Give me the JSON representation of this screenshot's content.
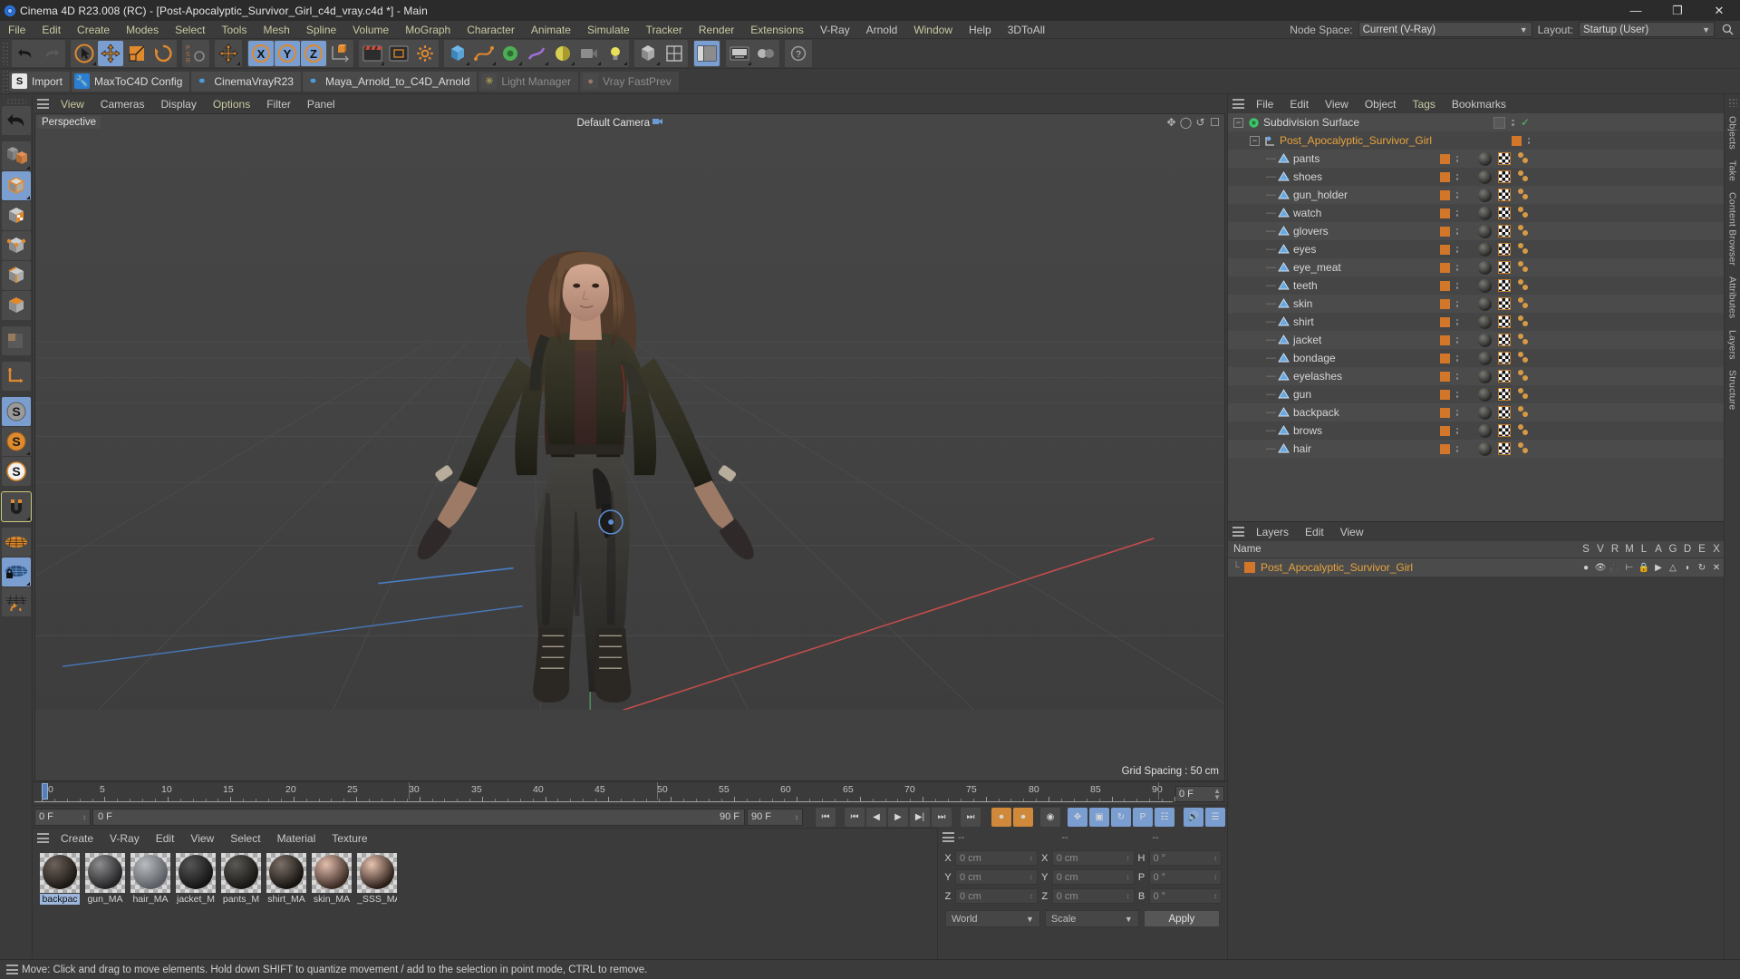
{
  "titlebar": {
    "app_name": "Cinema 4D R23.008 (RC)",
    "title": "Cinema 4D R23.008 (RC) - [Post-Apocalyptic_Survivor_Girl_c4d_vray.c4d *] - Main",
    "minimize": "—",
    "maximize": "❐",
    "close": "✕"
  },
  "menubar": {
    "items": [
      "File",
      "Edit",
      "Create",
      "Modes",
      "Select",
      "Tools",
      "Mesh",
      "Spline",
      "Volume",
      "MoGraph",
      "Character",
      "Animate",
      "Simulate",
      "Tracker",
      "Render",
      "Extensions",
      "V-Ray",
      "Arnold",
      "Window",
      "Help",
      "3DToAll"
    ],
    "node_space_label": "Node Space:",
    "node_space_value": "Current (V-Ray)",
    "layout_label": "Layout:",
    "layout_value": "Startup (User)",
    "search_icon": "search-icon"
  },
  "plugin_bar": {
    "items": [
      {
        "label": "Import",
        "icon": "import-icon",
        "dim": false
      },
      {
        "label": "MaxToC4D Config",
        "icon": "wrench-icon",
        "dim": false
      },
      {
        "label": "CinemaVrayR23",
        "icon": "python-icon",
        "dim": false
      },
      {
        "label": "Maya_Arnold_to_C4D_Arnold",
        "icon": "python-icon",
        "dim": false
      },
      {
        "label": "Light Manager",
        "icon": "light-icon",
        "dim": true
      },
      {
        "label": "Vray FastPrev",
        "icon": "vray-icon",
        "dim": true
      }
    ]
  },
  "viewport": {
    "menu": [
      "View",
      "Cameras",
      "Display",
      "Options",
      "Filter",
      "Panel"
    ],
    "label": "Perspective",
    "camera": "Default Camera",
    "grid_spacing": "Grid Spacing : 50 cm"
  },
  "timeline": {
    "ticks": [
      "0",
      "5",
      "10",
      "15",
      "20",
      "25",
      "30",
      "35",
      "40",
      "45",
      "50",
      "55",
      "60",
      "65",
      "70",
      "75",
      "80",
      "85",
      "90"
    ],
    "current_frame": "0 F",
    "start_frame": "0 F",
    "end_frame": "90 F",
    "preview_start": "0 F",
    "preview_end": "90 F",
    "max_frame": "90 F"
  },
  "material_manager": {
    "menu": [
      "Create",
      "V-Ray",
      "Edit",
      "View",
      "Select",
      "Material",
      "Texture"
    ],
    "materials": [
      {
        "name": "backpack_MAT",
        "short": "backpac",
        "selected": true,
        "c1": "#6e625c",
        "c2": "#1c1713"
      },
      {
        "name": "gun_MAT",
        "short": "gun_MA",
        "selected": false,
        "c1": "#8d8d8f",
        "c2": "#232325"
      },
      {
        "name": "hair_MAT",
        "short": "hair_MA",
        "selected": false,
        "c1": "#b9bcc0",
        "c2": "#5a5d63"
      },
      {
        "name": "jacket_MAT",
        "short": "jacket_M",
        "selected": false,
        "c1": "#565656",
        "c2": "#141414"
      },
      {
        "name": "pants_MAT",
        "short": "pants_M",
        "selected": false,
        "c1": "#5b5954",
        "c2": "#171614"
      },
      {
        "name": "shirt_MAT",
        "short": "shirt_MA",
        "selected": false,
        "c1": "#7c7068",
        "c2": "#15120f"
      },
      {
        "name": "skin_MAT",
        "short": "skin_MA",
        "selected": false,
        "c1": "#e4bfae",
        "c2": "#3a2a24"
      },
      {
        "name": "_SSS_MAT",
        "short": "_SSS_MA",
        "selected": false,
        "c1": "#e8c3b0",
        "c2": "#2a1d18"
      }
    ]
  },
  "object_manager": {
    "menu": [
      "File",
      "Edit",
      "View",
      "Object",
      "Tags",
      "Bookmarks"
    ],
    "rows": [
      {
        "name": "Subdivision Surface",
        "depth": 0,
        "icon": "subdivision-surface-icon",
        "selected": false,
        "has_tags": false,
        "check": true
      },
      {
        "name": "Post_Apocalyptic_Survivor_Girl",
        "depth": 1,
        "icon": "null-object-icon",
        "selected": true,
        "has_tags": false,
        "check": false
      },
      {
        "name": "pants",
        "depth": 2,
        "icon": "polygon-object-icon",
        "selected": false,
        "has_tags": true
      },
      {
        "name": "shoes",
        "depth": 2,
        "icon": "polygon-object-icon",
        "selected": false,
        "has_tags": true
      },
      {
        "name": "gun_holder",
        "depth": 2,
        "icon": "polygon-object-icon",
        "selected": false,
        "has_tags": true
      },
      {
        "name": "watch",
        "depth": 2,
        "icon": "polygon-object-icon",
        "selected": false,
        "has_tags": true
      },
      {
        "name": "glovers",
        "depth": 2,
        "icon": "polygon-object-icon",
        "selected": false,
        "has_tags": true
      },
      {
        "name": "eyes",
        "depth": 2,
        "icon": "polygon-object-icon",
        "selected": false,
        "has_tags": true
      },
      {
        "name": "eye_meat",
        "depth": 2,
        "icon": "polygon-object-icon",
        "selected": false,
        "has_tags": true
      },
      {
        "name": "teeth",
        "depth": 2,
        "icon": "polygon-object-icon",
        "selected": false,
        "has_tags": true
      },
      {
        "name": "skin",
        "depth": 2,
        "icon": "polygon-object-icon",
        "selected": false,
        "has_tags": true
      },
      {
        "name": "shirt",
        "depth": 2,
        "icon": "polygon-object-icon",
        "selected": false,
        "has_tags": true
      },
      {
        "name": "jacket",
        "depth": 2,
        "icon": "polygon-object-icon",
        "selected": false,
        "has_tags": true
      },
      {
        "name": "bondage",
        "depth": 2,
        "icon": "polygon-object-icon",
        "selected": false,
        "has_tags": true
      },
      {
        "name": "eyelashes",
        "depth": 2,
        "icon": "polygon-object-icon",
        "selected": false,
        "has_tags": true
      },
      {
        "name": "gun",
        "depth": 2,
        "icon": "polygon-object-icon",
        "selected": false,
        "has_tags": true
      },
      {
        "name": "backpack",
        "depth": 2,
        "icon": "polygon-object-icon",
        "selected": false,
        "has_tags": true
      },
      {
        "name": "brows",
        "depth": 2,
        "icon": "polygon-object-icon",
        "selected": false,
        "has_tags": true
      },
      {
        "name": "hair",
        "depth": 2,
        "icon": "polygon-object-icon",
        "selected": false,
        "has_tags": true
      }
    ]
  },
  "layer_manager": {
    "menu": [
      "Layers",
      "Edit",
      "View"
    ],
    "name_header": "Name",
    "columns": [
      "S",
      "V",
      "R",
      "M",
      "L",
      "A",
      "G",
      "D",
      "E",
      "X"
    ],
    "rows": [
      {
        "name": "Post_Apocalyptic_Survivor_Girl",
        "color": "#d2762a"
      }
    ]
  },
  "coordinates": {
    "header_dashes": [
      "--",
      "--",
      "--"
    ],
    "position": {
      "labels": [
        "X",
        "Y",
        "Z"
      ],
      "values": [
        "0 cm",
        "0 cm",
        "0 cm"
      ]
    },
    "size": {
      "labels": [
        "X",
        "Y",
        "Z"
      ],
      "values": [
        "0 cm",
        "0 cm",
        "0 cm"
      ]
    },
    "rotation": {
      "labels": [
        "H",
        "P",
        "B"
      ],
      "values": [
        "0 °",
        "0 °",
        "0 °"
      ]
    },
    "coord_system": "World",
    "mode": "Scale",
    "apply_label": "Apply"
  },
  "statusbar": {
    "message": "Move: Click and drag to move elements. Hold down SHIFT to quantize movement / add to the selection in point mode, CTRL to remove."
  },
  "right_tabs": [
    "Objects",
    "Take",
    "Content Browser",
    "Attributes",
    "Layers",
    "Structure"
  ],
  "colors": {
    "accent_orange": "#d2762a",
    "selected_blue": "#7b9ed1",
    "menu_yellow": "#c9c9a2",
    "layer_orange": "#e8a33d",
    "panel_bg": "#3b3b3b",
    "viewport_bg": "#414141"
  }
}
